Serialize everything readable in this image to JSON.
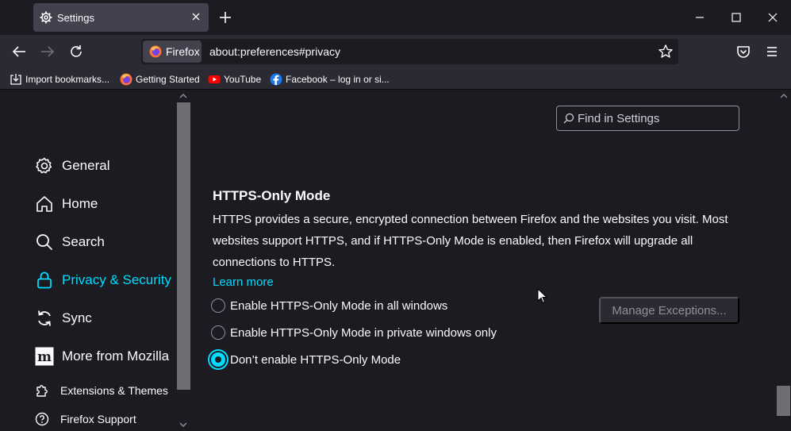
{
  "tab": {
    "title": "Settings"
  },
  "navbar": {
    "identity_label": "Firefox",
    "url": "about:preferences#privacy"
  },
  "bookmarks": [
    {
      "label": "Import bookmarks...",
      "icon": "import-icon"
    },
    {
      "label": "Getting Started",
      "icon": "firefox-icon"
    },
    {
      "label": "YouTube",
      "icon": "youtube-icon"
    },
    {
      "label": "Facebook – log in or si...",
      "icon": "facebook-icon"
    }
  ],
  "sidebar": {
    "categories": [
      {
        "label": "General",
        "icon": "gear-icon"
      },
      {
        "label": "Home",
        "icon": "home-icon"
      },
      {
        "label": "Search",
        "icon": "search-icon"
      },
      {
        "label": "Privacy & Security",
        "icon": "lock-icon",
        "selected": true
      },
      {
        "label": "Sync",
        "icon": "sync-icon"
      },
      {
        "label": "More from Mozilla",
        "icon": "mozilla-icon"
      }
    ],
    "footer": [
      {
        "label": "Extensions & Themes",
        "icon": "puzzle-icon"
      },
      {
        "label": "Firefox Support",
        "icon": "help-icon"
      }
    ]
  },
  "main": {
    "search_placeholder": "Find in Settings",
    "section_title": "HTTPS-Only Mode",
    "description": "HTTPS provides a secure, encrypted connection between Firefox and the websites you visit. Most websites support HTTPS, and if HTTPS-Only Mode is enabled, then Firefox will upgrade all connections to HTTPS.",
    "learn_more": "Learn more",
    "options": [
      {
        "label": "Enable HTTPS-Only Mode in all windows",
        "checked": false
      },
      {
        "label": "Enable HTTPS-Only Mode in private windows only",
        "checked": false
      },
      {
        "label": "Don’t enable HTTPS-Only Mode",
        "checked": true
      }
    ],
    "manage_button": "Manage Exceptions..."
  },
  "colors": {
    "accent": "#00ddff",
    "background": "#1c1b22",
    "toolbar": "#2b2a33"
  }
}
